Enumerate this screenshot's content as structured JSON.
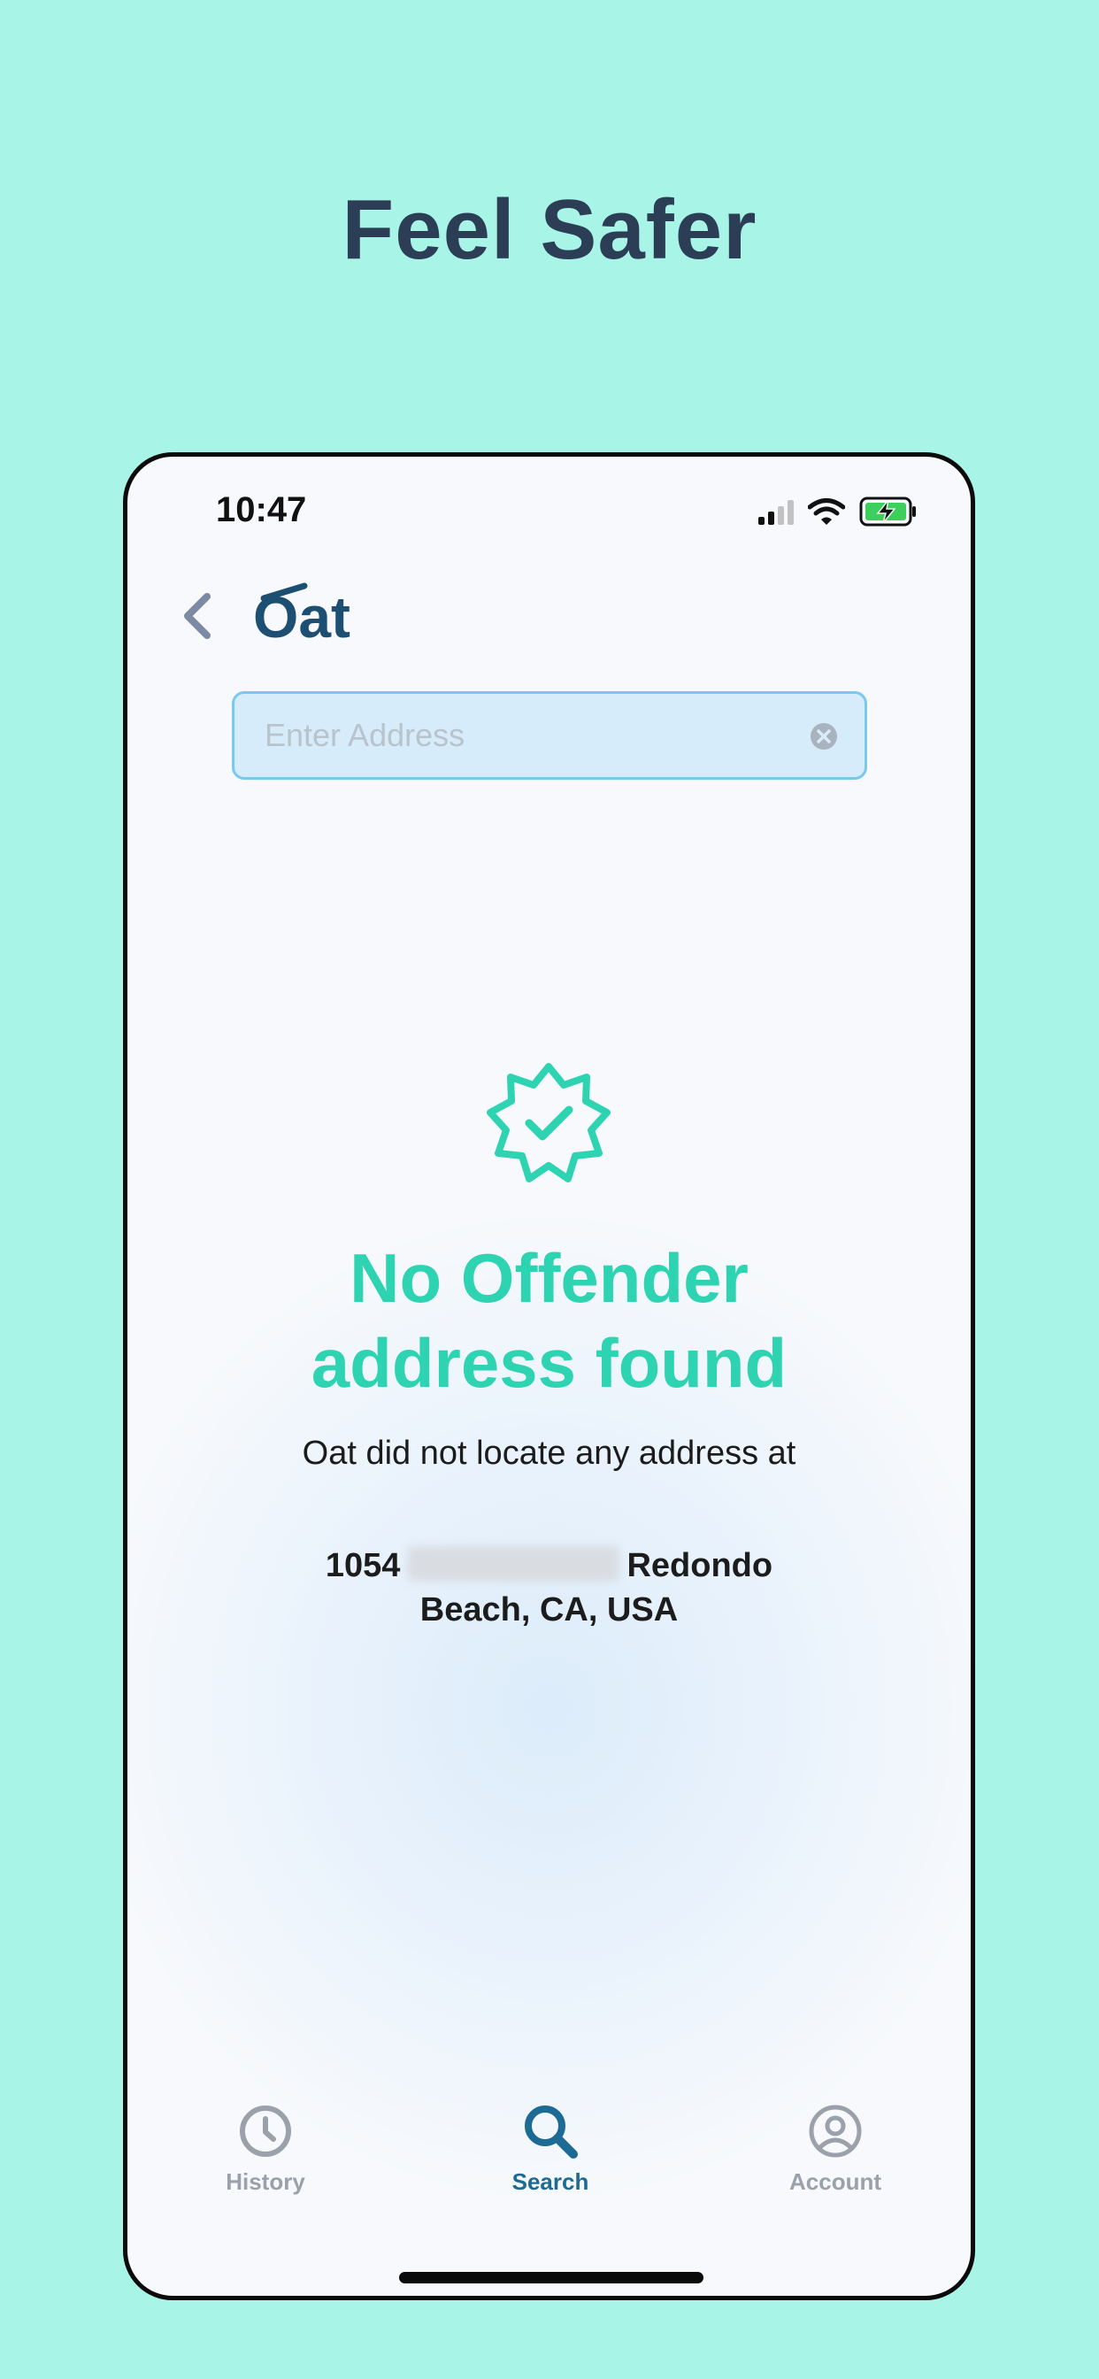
{
  "promo": {
    "headline": "Feel Safer"
  },
  "status_bar": {
    "time": "10:47"
  },
  "app": {
    "logo_text": "Oat"
  },
  "search": {
    "placeholder": "Enter Address",
    "value": ""
  },
  "result": {
    "title_line1": "No Offender",
    "title_line2": "address found",
    "subtitle": "Oat did not locate any address at",
    "address_prefix": "1054",
    "address_suffix": "Redondo",
    "address_line2": "Beach, CA, USA"
  },
  "tabs": [
    {
      "label": "History",
      "icon": "clock-icon",
      "active": false
    },
    {
      "label": "Search",
      "icon": "search-icon",
      "active": true
    },
    {
      "label": "Account",
      "icon": "user-circle-icon",
      "active": false
    }
  ],
  "colors": {
    "background": "#a8f5e8",
    "accent": "#2ed3b2",
    "brand": "#1d4f73",
    "active_tab": "#1d6a95",
    "inactive_tab": "#9aa1aa",
    "search_fill": "#d7ecfb",
    "search_border": "#79c9ee"
  }
}
